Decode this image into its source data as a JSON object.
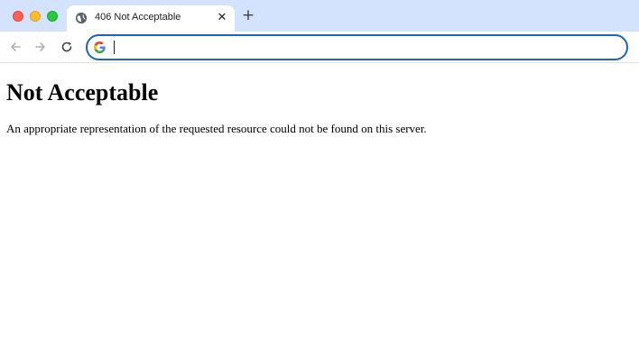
{
  "browser": {
    "tab": {
      "title": "406 Not Acceptable",
      "favicon": "globe-icon",
      "close_label": "✕"
    },
    "new_tab_label": "+",
    "toolbar": {
      "back_icon": "arrow-left-icon",
      "forward_icon": "arrow-right-icon",
      "reload_icon": "reload-icon",
      "omnibox_value": "",
      "omnibox_icon": "google-icon"
    },
    "colors": {
      "tabstrip": "#d3e3fd",
      "omnibox_focus": "#1a63c7"
    }
  },
  "page": {
    "heading": "Not Acceptable",
    "message": "An appropriate representation of the requested resource could not be found on this server."
  }
}
